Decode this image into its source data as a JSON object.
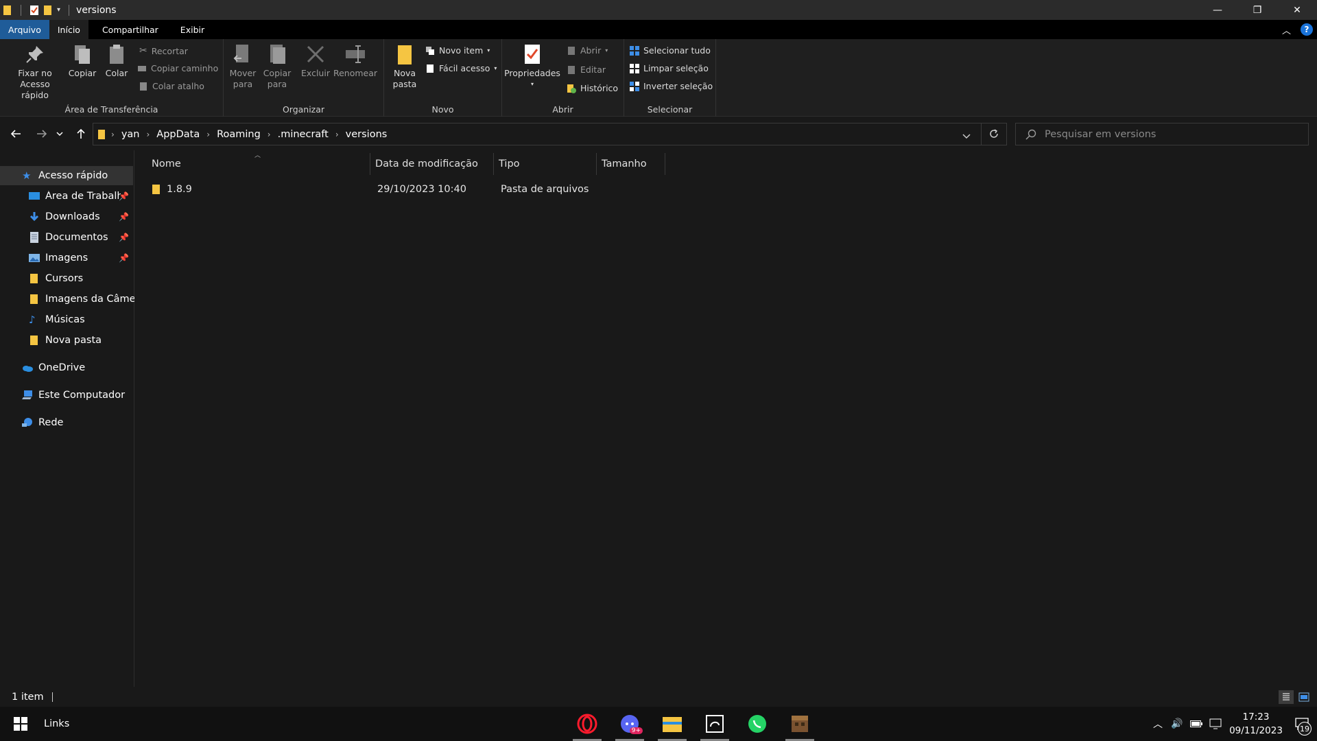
{
  "window": {
    "title": "versions",
    "controls": {
      "minimize": "—",
      "maximize": "❐",
      "close": "✕"
    }
  },
  "ribbon": {
    "tabs": [
      {
        "label": "Arquivo"
      },
      {
        "label": "Início"
      },
      {
        "label": "Compartilhar"
      },
      {
        "label": "Exibir"
      }
    ],
    "help": "?",
    "groups": {
      "clipboard": {
        "label": "Área de Transferência",
        "pin_line1": "Fixar no",
        "pin_line2": "Acesso rápido",
        "copy": "Copiar",
        "paste": "Colar",
        "cut": "Recortar",
        "copy_path": "Copiar caminho",
        "paste_shortcut": "Colar atalho"
      },
      "organize": {
        "label": "Organizar",
        "move_line1": "Mover",
        "move_line2": "para",
        "copy_line1": "Copiar",
        "copy_line2": "para",
        "delete": "Excluir",
        "rename": "Renomear"
      },
      "new": {
        "label": "Novo",
        "new_folder_line1": "Nova",
        "new_folder_line2": "pasta",
        "new_item": "Novo item",
        "easy_access": "Fácil acesso"
      },
      "open": {
        "label": "Abrir",
        "properties": "Propriedades",
        "open": "Abrir",
        "edit": "Editar",
        "history": "Histórico"
      },
      "select": {
        "label": "Selecionar",
        "select_all": "Selecionar tudo",
        "select_none": "Limpar seleção",
        "invert": "Inverter seleção"
      }
    }
  },
  "address": {
    "breadcrumbs": [
      "yan",
      "AppData",
      "Roaming",
      ".minecraft",
      "versions"
    ]
  },
  "search": {
    "placeholder": "Pesquisar em versions"
  },
  "sidebar": {
    "quick_access": "Acesso rápido",
    "items": [
      {
        "label": "Área de Trabalho",
        "pinned": true
      },
      {
        "label": "Downloads",
        "pinned": true
      },
      {
        "label": "Documentos",
        "pinned": true
      },
      {
        "label": "Imagens",
        "pinned": true
      },
      {
        "label": "Cursors",
        "pinned": false
      },
      {
        "label": "Imagens da Câmera",
        "pinned": false
      },
      {
        "label": "Músicas",
        "pinned": false
      },
      {
        "label": "Nova pasta",
        "pinned": false
      }
    ],
    "onedrive": "OneDrive",
    "this_pc": "Este Computador",
    "network": "Rede"
  },
  "list": {
    "columns": {
      "name": "Nome",
      "modified": "Data de modificação",
      "type": "Tipo",
      "size": "Tamanho"
    },
    "rows": [
      {
        "name": "1.8.9",
        "modified": "29/10/2023 10:40",
        "type": "Pasta de arquivos",
        "size": ""
      }
    ]
  },
  "status": {
    "count": "1 item"
  },
  "taskbar": {
    "links": "Links",
    "clock_time": "17:23",
    "clock_date": "09/11/2023",
    "notification_count": "19",
    "discord_badge": "9+"
  },
  "colors": {
    "accent": "#1f5c99",
    "folder": "#f5c542",
    "background": "#191919"
  }
}
